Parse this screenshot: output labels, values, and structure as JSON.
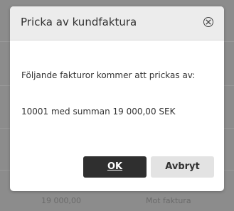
{
  "dialog": {
    "title": "Pricka av kundfaktura",
    "message": "Följande fakturor kommer att prickas av:",
    "invoice_line": "10001 med summan 19 000,00 SEK",
    "ok_label": "OK",
    "cancel_label": "Avbryt",
    "close_icon": "close-circle-icon"
  },
  "background": {
    "amount_text": "19 000,00",
    "status_text": "Mot faktura"
  },
  "colors": {
    "ok_button": "#2f2f2f",
    "cancel_button": "#e3e3e3",
    "header": "#ececec",
    "backdrop": "#8c8c8c"
  }
}
